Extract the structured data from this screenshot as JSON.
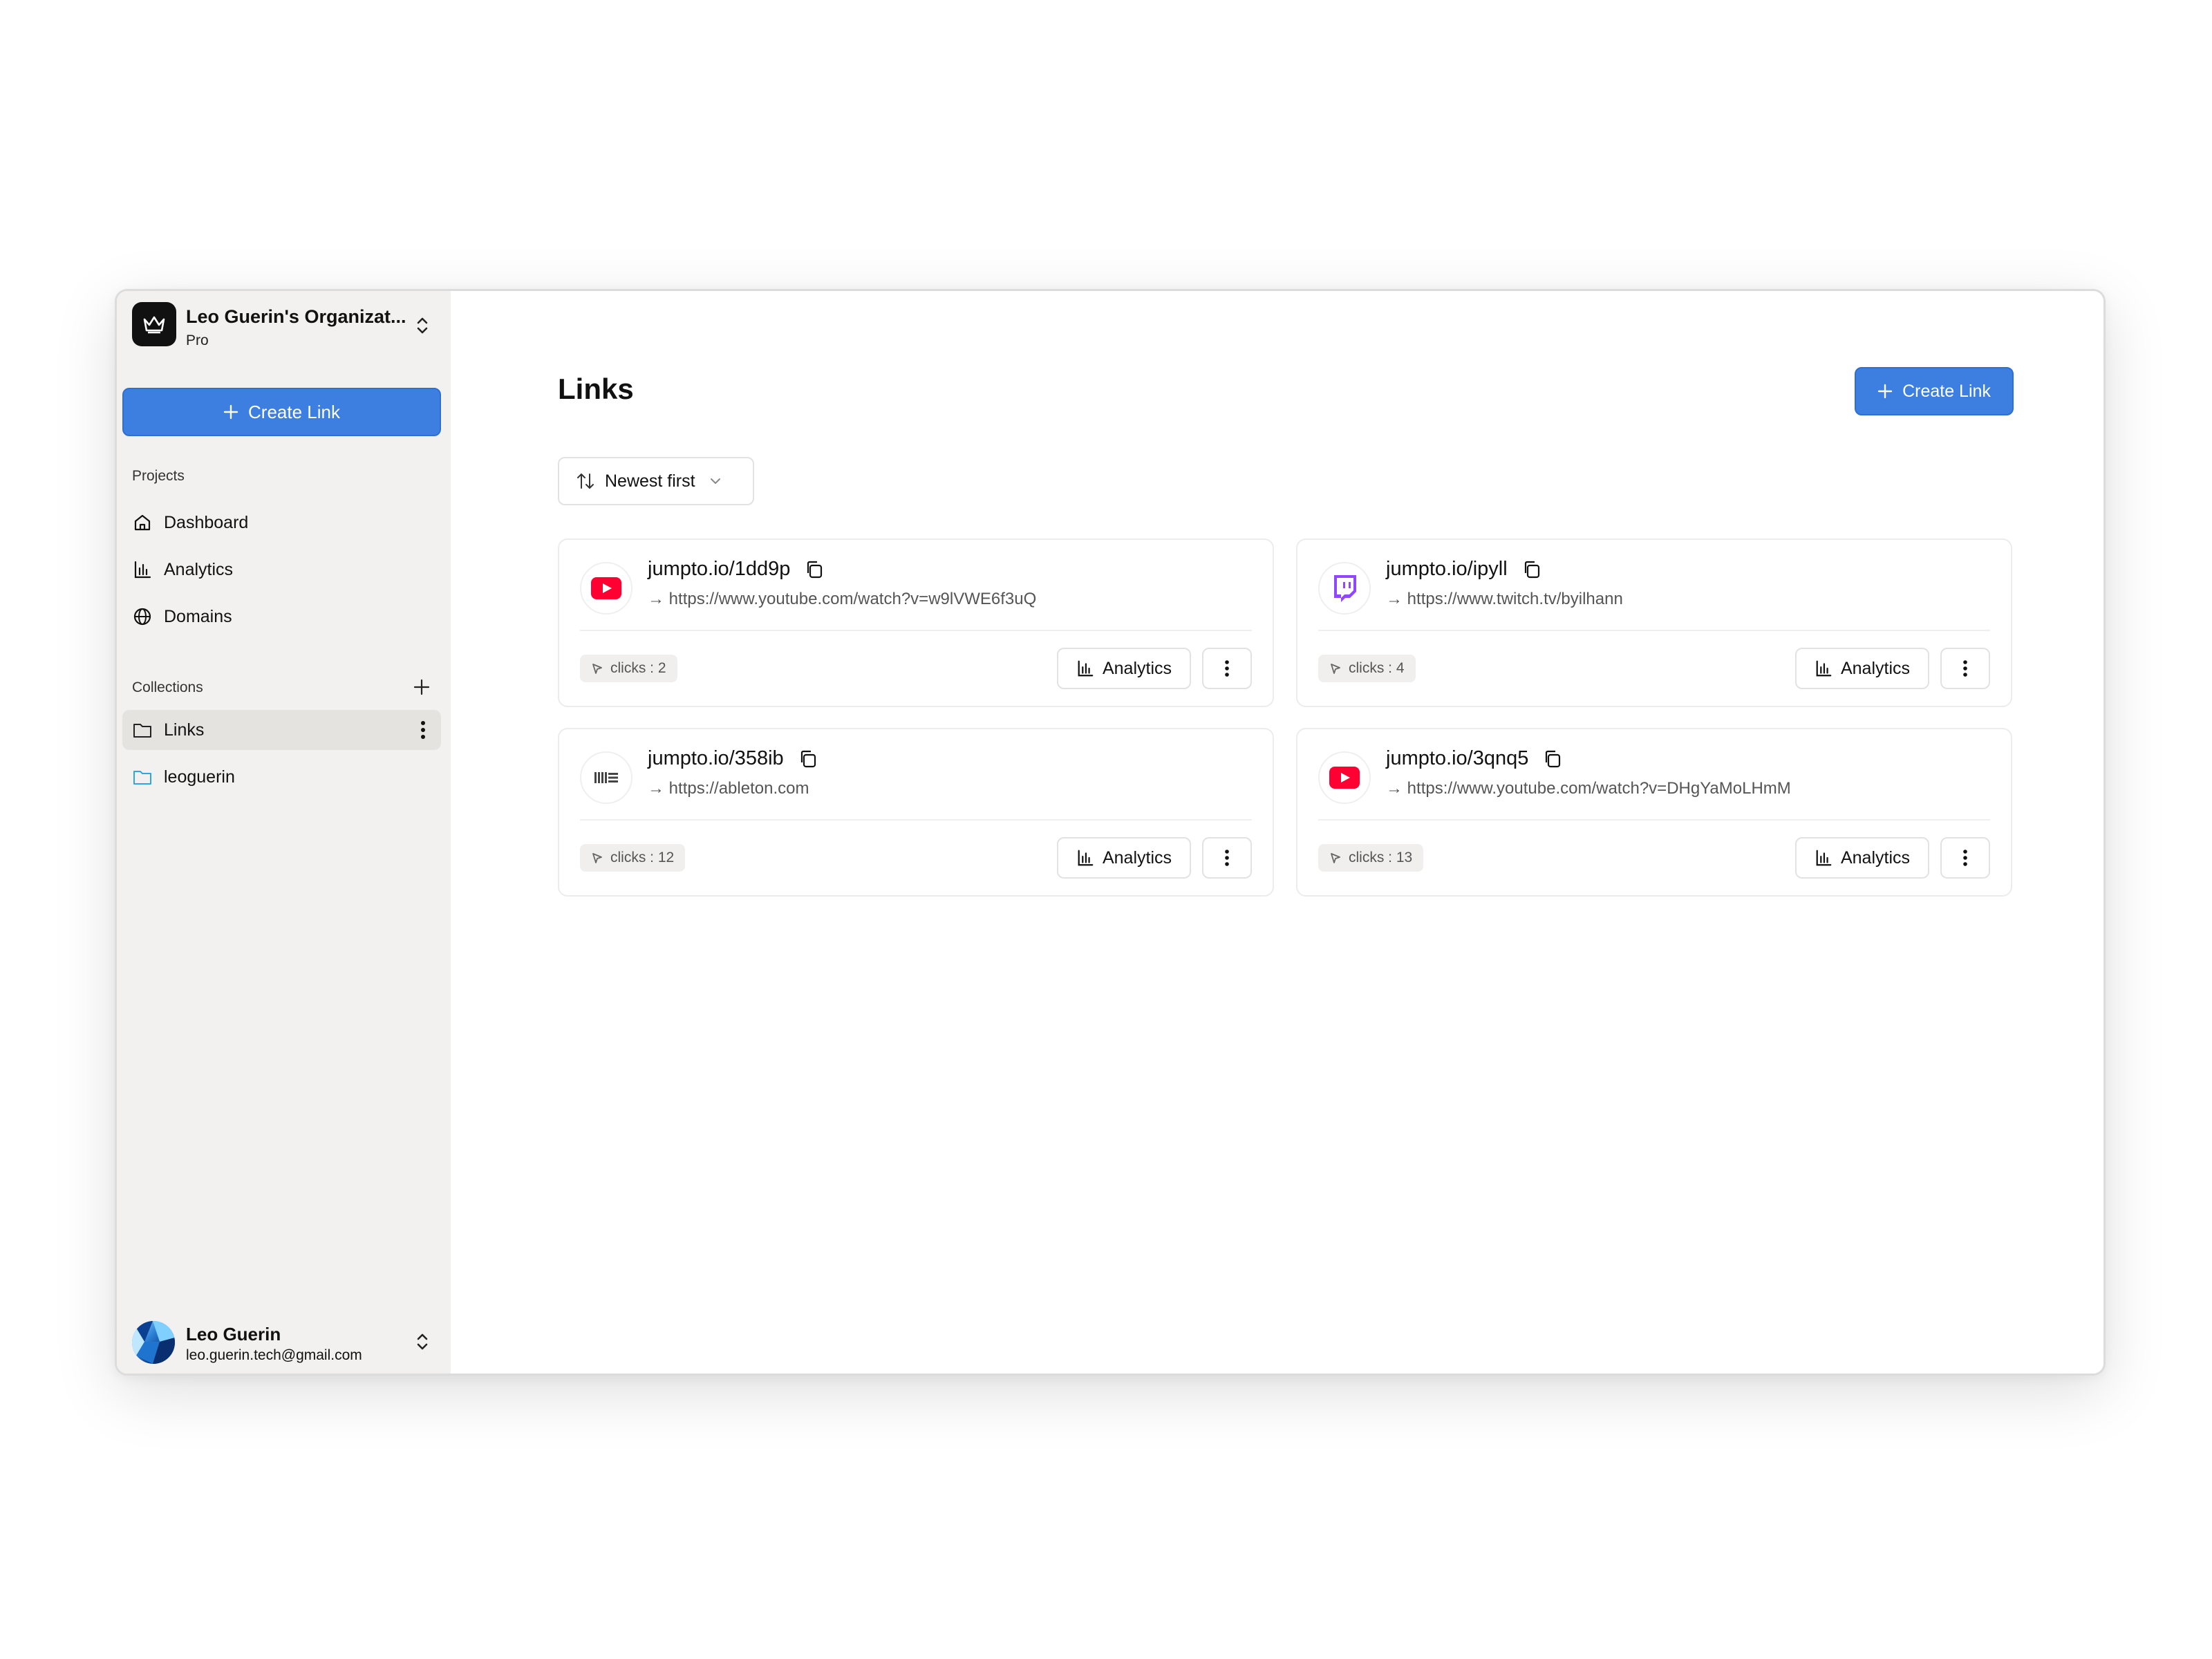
{
  "org": {
    "name": "Leo Guerin's Organizat...",
    "plan": "Pro"
  },
  "sidebar": {
    "create_label": "Create Link",
    "projects_label": "Projects",
    "projects": [
      {
        "label": "Dashboard",
        "icon": "home-icon"
      },
      {
        "label": "Analytics",
        "icon": "bar-chart-icon"
      },
      {
        "label": "Domains",
        "icon": "globe-icon"
      }
    ],
    "collections_label": "Collections",
    "collections": [
      {
        "label": "Links",
        "icon": "folder-icon",
        "active": true
      },
      {
        "label": "leoguerin",
        "icon": "folder-icon",
        "color": "#2ea7e0"
      }
    ]
  },
  "user": {
    "name": "Leo Guerin",
    "email": "leo.guerin.tech@gmail.com"
  },
  "main": {
    "title": "Links",
    "create_label": "Create Link",
    "sort_label": "Newest first"
  },
  "links": [
    {
      "short": "jumpto.io/1dd9p",
      "dest": "https://www.youtube.com/watch?v=w9lVWE6f3uQ",
      "clicks": "clicks : 2",
      "favicon": "youtube-icon",
      "analytics": "Analytics"
    },
    {
      "short": "jumpto.io/ipyll",
      "dest": "https://www.twitch.tv/byilhann",
      "clicks": "clicks : 4",
      "favicon": "twitch-icon",
      "analytics": "Analytics"
    },
    {
      "short": "jumpto.io/358ib",
      "dest": "https://ableton.com",
      "clicks": "clicks : 12",
      "favicon": "ableton-icon",
      "analytics": "Analytics"
    },
    {
      "short": "jumpto.io/3qnq5",
      "dest": "https://www.youtube.com/watch?v=DHgYaMoLHmM",
      "clicks": "clicks : 13",
      "favicon": "youtube-icon",
      "analytics": "Analytics"
    }
  ],
  "colors": {
    "accent": "#3c7fe0",
    "youtube": "#ff0033",
    "twitch": "#9146ff",
    "sidebar_bg": "#f2f1ef"
  }
}
